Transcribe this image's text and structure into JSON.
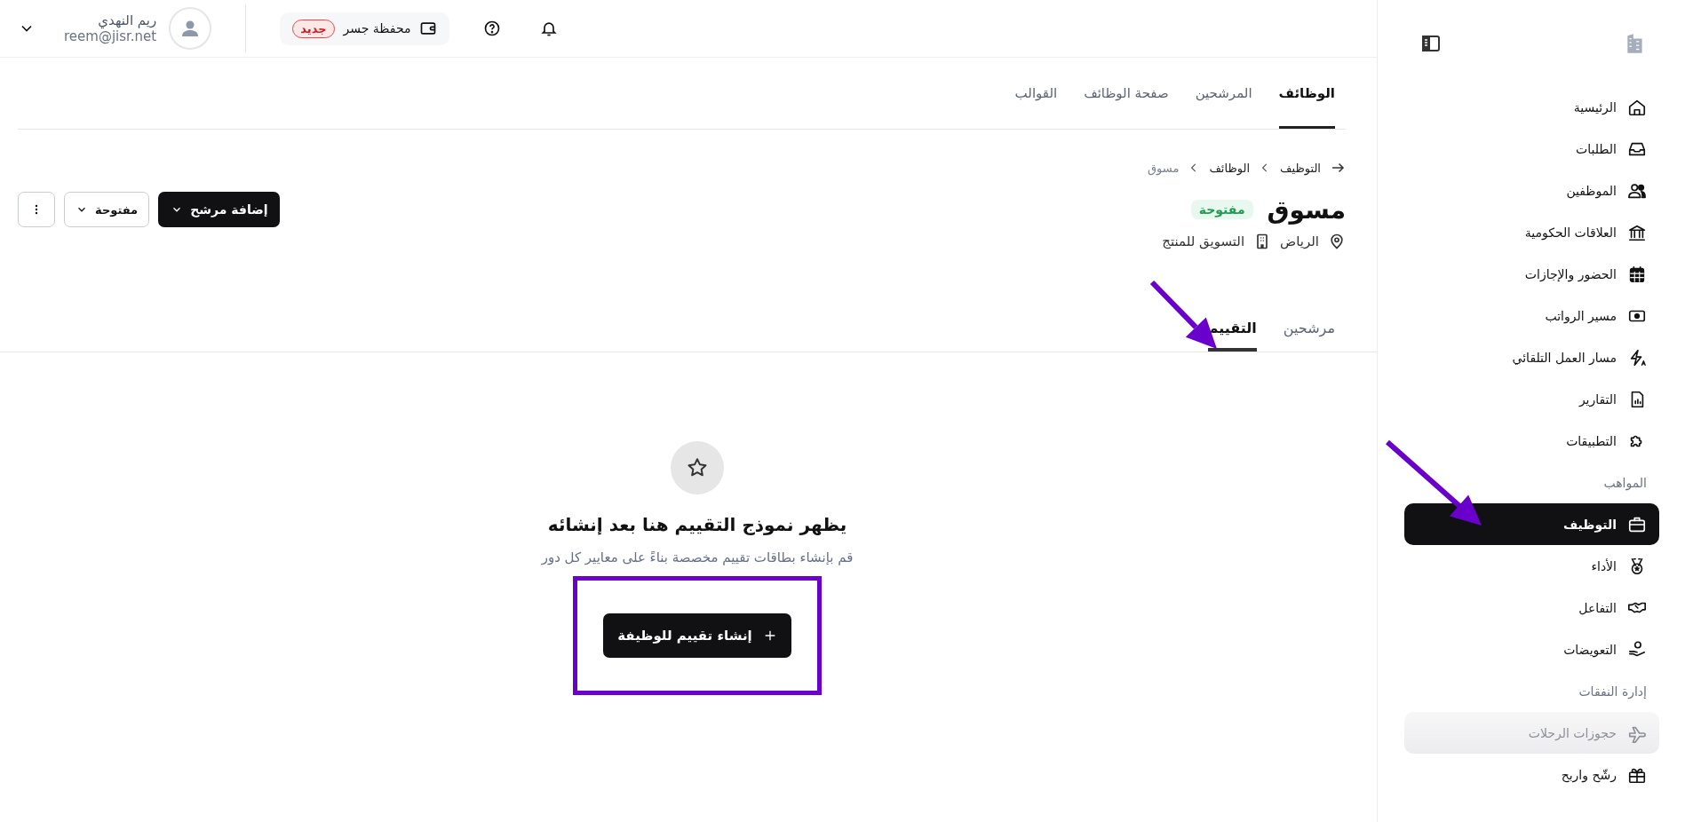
{
  "topbar": {
    "user": {
      "name": "ريم النهدي",
      "email": "reem@jisr.net"
    },
    "wallet": {
      "label": "محفظة جسر",
      "badge": "جديد"
    }
  },
  "nav_tabs": [
    {
      "label": "الوظائف",
      "selected": true
    },
    {
      "label": "المرشحين",
      "selected": false
    },
    {
      "label": "صفحة الوظائف",
      "selected": false
    },
    {
      "label": "القوالب",
      "selected": false
    }
  ],
  "breadcrumb": [
    "التوظيف",
    "الوظائف",
    "مسوق"
  ],
  "job": {
    "title": "مسوق",
    "status": "مفتوحة",
    "location": "الرياض",
    "department": "التسويق للمنتج"
  },
  "actions": {
    "add_candidate": "إضافة مرشح",
    "status_menu": "مفتوحة"
  },
  "job_tabs": [
    {
      "label": "مرشحين",
      "selected": false
    },
    {
      "label": "التقييم",
      "selected": true
    }
  ],
  "empty_state": {
    "title": "يظهر نموذج التقييم هنا بعد إنشائه",
    "description": "قم بإنشاء بطاقات تقييم مخصصة بناءً على معايير كل دور",
    "button": "إنشاء تقييم للوظيفة"
  },
  "sidebar": {
    "items": [
      {
        "kind": "item",
        "label": "الرئيسية",
        "selected": false,
        "disabled": false
      },
      {
        "kind": "item",
        "label": "الطلبات",
        "selected": false,
        "disabled": false
      },
      {
        "kind": "item",
        "label": "الموظفين",
        "selected": false,
        "disabled": false
      },
      {
        "kind": "item",
        "label": "العلاقات الحكومية",
        "selected": false,
        "disabled": false
      },
      {
        "kind": "item",
        "label": "الحضور والإجازات",
        "selected": false,
        "disabled": false
      },
      {
        "kind": "item",
        "label": "مسير الرواتب",
        "selected": false,
        "disabled": false
      },
      {
        "kind": "item",
        "label": "مسار العمل التلقائي",
        "selected": false,
        "disabled": false
      },
      {
        "kind": "item",
        "label": "التقارير",
        "selected": false,
        "disabled": false
      },
      {
        "kind": "item",
        "label": "التطبيقات",
        "selected": false,
        "disabled": false
      },
      {
        "kind": "section",
        "label": "المواهب"
      },
      {
        "kind": "item",
        "label": "التوظيف",
        "selected": true,
        "disabled": false
      },
      {
        "kind": "item",
        "label": "الأداء",
        "selected": false,
        "disabled": false
      },
      {
        "kind": "item",
        "label": "التفاعل",
        "selected": false,
        "disabled": false
      },
      {
        "kind": "item",
        "label": "التعويضات",
        "selected": false,
        "disabled": false
      },
      {
        "kind": "section",
        "label": "إدارة النفقات"
      },
      {
        "kind": "item",
        "label": "حجوزات الرحلات",
        "selected": false,
        "disabled": true
      },
      {
        "kind": "item",
        "label": "رشّح واربح",
        "selected": false,
        "disabled": false
      }
    ]
  },
  "annotations": [
    {
      "kind": "arrow"
    },
    {
      "kind": "arrow"
    },
    {
      "kind": "frame"
    }
  ]
}
